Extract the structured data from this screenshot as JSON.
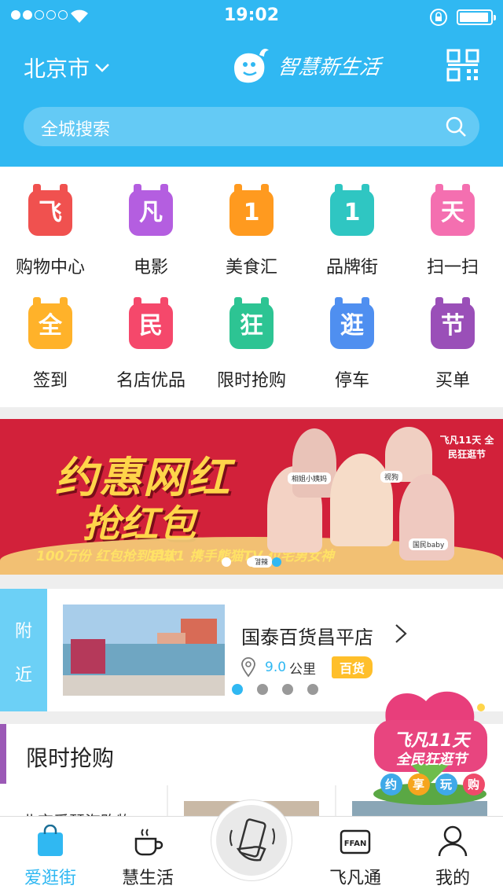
{
  "status_bar": {
    "time": "19:02",
    "signal_filled": 2,
    "signal_total": 5
  },
  "header": {
    "city": "北京市",
    "logo_text": "智慧新生活",
    "search_placeholder": "全城搜索"
  },
  "categories": [
    {
      "label": "购物中心",
      "glyph": "飞",
      "color": "#f0514f",
      "icon": "shopping-center-icon"
    },
    {
      "label": "电影",
      "glyph": "凡",
      "color": "#b45ee0",
      "icon": "movie-icon"
    },
    {
      "label": "美食汇",
      "glyph": "1",
      "color": "#ff9a1f",
      "icon": "food-icon"
    },
    {
      "label": "品牌街",
      "glyph": "1",
      "color": "#2fc6c2",
      "icon": "brand-street-icon"
    },
    {
      "label": "扫一扫",
      "glyph": "天",
      "color": "#f46fb0",
      "icon": "scan-icon"
    },
    {
      "label": "签到",
      "glyph": "全",
      "color": "#ffb22a",
      "icon": "checkin-icon"
    },
    {
      "label": "名店优品",
      "glyph": "民",
      "color": "#f5486b",
      "icon": "famous-store-icon"
    },
    {
      "label": "限时抢购",
      "glyph": "狂",
      "color": "#2dc493",
      "icon": "flash-sale-icon"
    },
    {
      "label": "停车",
      "glyph": "逛",
      "color": "#4f8ff0",
      "icon": "parking-icon"
    },
    {
      "label": "买单",
      "glyph": "节",
      "color": "#9a4fb8",
      "icon": "pay-bill-icon"
    }
  ],
  "banner": {
    "line1": "约惠网红",
    "line2": "抢红包",
    "promo1": "100万份 红包抢到手软",
    "promo2": "1111 携手熊猫TV 位宅男女神",
    "festival": "飞凡11天 全民狂逛节",
    "tags": [
      "相姐小姨妈",
      "视狗",
      "国民baby",
      "甜辣"
    ],
    "slides": 3,
    "active_slide": 3
  },
  "nearby": {
    "tab_label_1": "附",
    "tab_label_2": "近",
    "shop_name": "国泰百货昌平店",
    "distance": "9.0",
    "distance_unit": "公里",
    "category": "百货",
    "slides": 4,
    "active_slide": 1
  },
  "flash_sale": {
    "title": "限时抢购",
    "first_item_text": "北京爱琴海购物"
  },
  "promo_float": {
    "title": "飞凡11天",
    "subtitle": "全民狂逛节",
    "chips": [
      "约",
      "享",
      "玩",
      "购"
    ]
  },
  "tabbar": [
    {
      "label": "爱逛街",
      "icon": "shopping-bag-icon",
      "active": true
    },
    {
      "label": "慧生活",
      "icon": "coffee-cup-icon",
      "active": false
    },
    {
      "label": "",
      "icon": "phone-scan-icon",
      "active": false
    },
    {
      "label": "飞凡通",
      "icon": "ffan-card-icon",
      "active": false
    },
    {
      "label": "我的",
      "icon": "user-icon",
      "active": false
    }
  ],
  "colors": {
    "primary": "#30b8f2",
    "banner_red": "#d2213a",
    "badge_yellow": "#ffbf2a"
  }
}
